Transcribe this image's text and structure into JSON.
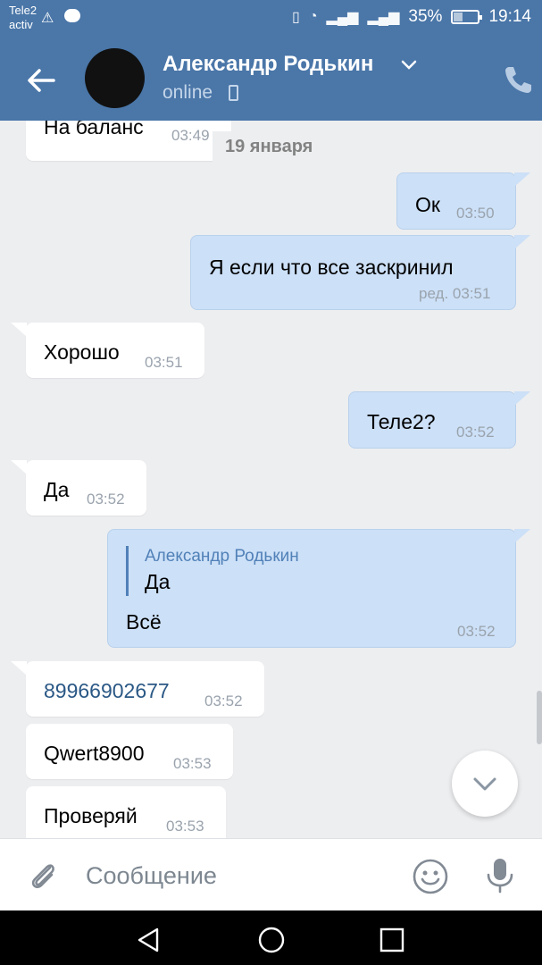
{
  "status_bar": {
    "carrier_line1": "Tele2",
    "carrier_line2": "activ",
    "battery": "35%",
    "time": "19:14",
    "battery_level": 0.35
  },
  "header": {
    "contact_name": "Александр Родькин",
    "status": "online",
    "bg_color": "#4a76a8"
  },
  "messages": {
    "m1": {
      "text": "На баланс",
      "time": "03:49"
    },
    "date_separator": "19 января",
    "m2": {
      "text": "Ок",
      "time": "03:50"
    },
    "m3": {
      "text": "Я если что все заскринил",
      "edited": "ред.",
      "time": "03:51"
    },
    "m4": {
      "text": "Хорошо",
      "time": "03:51"
    },
    "m5": {
      "text": "Теле2?",
      "time": "03:52"
    },
    "m6": {
      "text": "Да",
      "time": "03:52"
    },
    "m7": {
      "reply_author": "Александр Родькин",
      "reply_text": "Да",
      "text": "Всё",
      "time": "03:52"
    },
    "m8": {
      "text": "89966902677",
      "time": "03:52"
    },
    "m9": {
      "text": "Qwert8900",
      "time": "03:53"
    },
    "m10": {
      "text": "Проверяй",
      "time": "03:53"
    }
  },
  "composer": {
    "placeholder": "Сообщение"
  },
  "icons": [
    "back-arrow-icon",
    "phone-icon",
    "chevron-down-icon",
    "attach-icon",
    "smile-icon",
    "mic-icon",
    "scroll-down-icon",
    "nav-back-icon",
    "nav-home-icon",
    "nav-recent-icon"
  ],
  "colors": {
    "incoming_bubble": "#ffffff",
    "outgoing_bubble": "#cce0f7",
    "link": "#2a5885",
    "background": "#edeef0"
  }
}
